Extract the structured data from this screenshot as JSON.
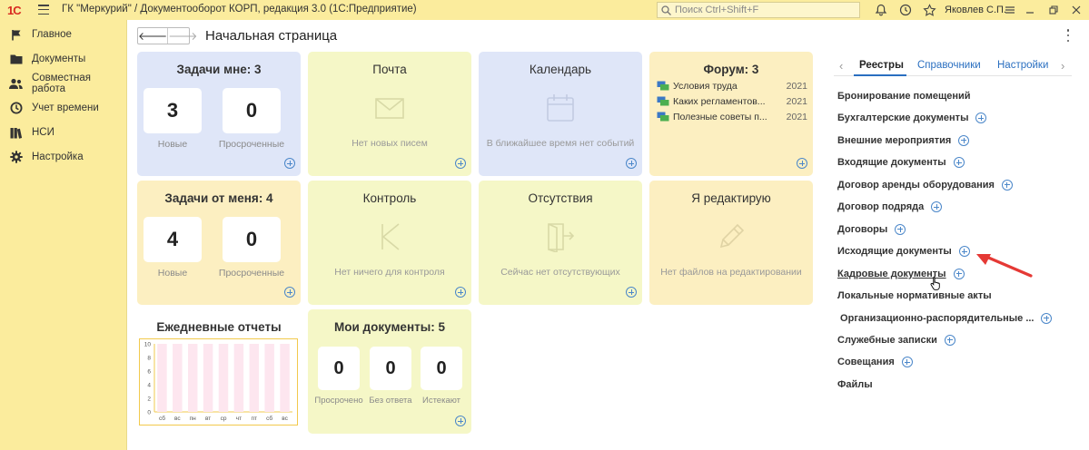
{
  "app": {
    "logo_text": "1С",
    "title": "ГК \"Меркурий\" / Документооборот КОРП, редакция 3.0  (1С:Предприятие)",
    "search_placeholder": "Поиск Ctrl+Shift+F",
    "user": "Яковлев С.П."
  },
  "sidebar": {
    "items": [
      {
        "label": "Главное",
        "icon": "flag-icon"
      },
      {
        "label": "Документы",
        "icon": "folder-icon"
      },
      {
        "label": "Совместная работа",
        "icon": "users-icon"
      },
      {
        "label": "Учет времени",
        "icon": "clock-icon"
      },
      {
        "label": "НСИ",
        "icon": "books-icon"
      },
      {
        "label": "Настройка",
        "icon": "gear-icon"
      }
    ]
  },
  "header": {
    "title": "Начальная страница"
  },
  "tiles": {
    "tasks_me": {
      "title": "Задачи мне: 3",
      "new_count": "3",
      "new_label": "Новые",
      "overdue_count": "0",
      "overdue_label": "Просроченные"
    },
    "mail": {
      "title": "Почта",
      "empty": "Нет новых писем"
    },
    "calendar": {
      "title": "Календарь",
      "empty": "В ближайшее время нет событий"
    },
    "forum": {
      "title": "Форум: 3",
      "topics": [
        {
          "title": "Условия труда",
          "year": "2021"
        },
        {
          "title": "Каких регламентов...",
          "year": "2021"
        },
        {
          "title": "Полезные советы п...",
          "year": "2021"
        }
      ]
    },
    "tasks_from_me": {
      "title": "Задачи от меня: 4",
      "new_count": "4",
      "new_label": "Новые",
      "overdue_count": "0",
      "overdue_label": "Просроченные"
    },
    "control": {
      "title": "Контроль",
      "empty": "Нет ничего для контроля"
    },
    "absences": {
      "title": "Отсутствия",
      "empty": "Сейчас нет отсутствующих"
    },
    "editing": {
      "title": "Я редактирую",
      "empty": "Нет файлов на редактировании"
    },
    "daily_reports": {
      "title": "Ежедневные отчеты"
    },
    "my_docs": {
      "title": "Мои документы: 5",
      "overdue_count": "0",
      "overdue_label": "Просрочено",
      "no_answer_count": "0",
      "no_answer_label": "Без ответа",
      "expiring_count": "0",
      "expiring_label": "Истекают"
    }
  },
  "chart_data": {
    "type": "bar",
    "categories": [
      "сб",
      "вс",
      "пн",
      "вт",
      "ср",
      "чт",
      "пт",
      "сб",
      "вс"
    ],
    "values": [
      10,
      10,
      10,
      10,
      10,
      10,
      10,
      10,
      10
    ],
    "yticks": [
      "0",
      "2",
      "4",
      "6",
      "8",
      "10"
    ],
    "ylim": [
      0,
      10
    ],
    "bar_color": "#fde6ef",
    "axis_color": "#f2c94c"
  },
  "right_panel": {
    "tabs": [
      {
        "label": "Реестры",
        "active": true
      },
      {
        "label": "Справочники",
        "active": false
      },
      {
        "label": "Настройки",
        "active": false
      }
    ],
    "registers": [
      {
        "label": "Бронирование помещений",
        "plus": false
      },
      {
        "label": "Бухгалтерские документы",
        "plus": true
      },
      {
        "label": "Внешние мероприятия",
        "plus": true
      },
      {
        "label": "Входящие документы",
        "plus": true
      },
      {
        "label": "Договор аренды оборудования",
        "plus": true
      },
      {
        "label": "Договор подряда",
        "plus": true
      },
      {
        "label": "Договоры",
        "plus": true
      },
      {
        "label": "Исходящие документы",
        "plus": true
      },
      {
        "label": "Кадровые документы",
        "plus": true,
        "hovered": true
      },
      {
        "label": "Локальные нормативные акты",
        "plus": false
      },
      {
        "label": " Организационно-распорядительные ...",
        "plus": true
      },
      {
        "label": "Служебные записки",
        "plus": true
      },
      {
        "label": "Совещания",
        "plus": true
      },
      {
        "label": "Файлы",
        "plus": false
      }
    ]
  },
  "colors": {
    "chrome": "#fbec9d",
    "tile_blue": "#dfe6f8",
    "tile_yellow": "#fcefc1",
    "tile_green": "#f5f7c7",
    "accent": "#2a6fc0",
    "annotation_arrow": "#e53935"
  }
}
